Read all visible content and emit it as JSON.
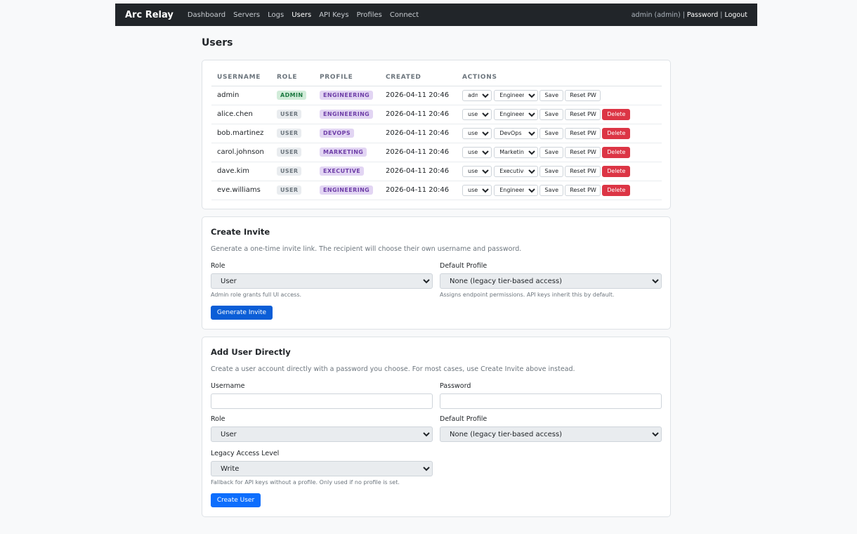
{
  "nav": {
    "brand": "Arc Relay",
    "links": [
      "Dashboard",
      "Servers",
      "Logs",
      "Users",
      "API Keys",
      "Profiles",
      "Connect"
    ],
    "active": "Users",
    "user_label": "admin (admin)",
    "password_link": "Password",
    "logout_link": "Logout",
    "separator": "|"
  },
  "page": {
    "title": "Users"
  },
  "users_table": {
    "headers": [
      "USERNAME",
      "ROLE",
      "PROFILE",
      "CREATED",
      "ACTIONS"
    ],
    "rows": [
      {
        "username": "admin",
        "role_badge": "ADMIN",
        "profile_badge": "ENGINEERING",
        "created": "2026-04-11 20:46",
        "role_select": "admin",
        "profile_select": "Engineering",
        "deletable": false
      },
      {
        "username": "alice.chen",
        "role_badge": "USER",
        "profile_badge": "ENGINEERING",
        "created": "2026-04-11 20:46",
        "role_select": "user",
        "profile_select": "Engineering",
        "deletable": true
      },
      {
        "username": "bob.martinez",
        "role_badge": "USER",
        "profile_badge": "DEVOPS",
        "created": "2026-04-11 20:46",
        "role_select": "user",
        "profile_select": "DevOps",
        "deletable": true
      },
      {
        "username": "carol.johnson",
        "role_badge": "USER",
        "profile_badge": "MARKETING",
        "created": "2026-04-11 20:46",
        "role_select": "user",
        "profile_select": "Marketing",
        "deletable": true
      },
      {
        "username": "dave.kim",
        "role_badge": "USER",
        "profile_badge": "EXECUTIVE",
        "created": "2026-04-11 20:46",
        "role_select": "user",
        "profile_select": "Executive",
        "deletable": true
      },
      {
        "username": "eve.williams",
        "role_badge": "USER",
        "profile_badge": "ENGINEERING",
        "created": "2026-04-11 20:46",
        "role_select": "user",
        "profile_select": "Engineering",
        "deletable": true
      }
    ],
    "save_label": "Save",
    "reset_label": "Reset PW",
    "delete_label": "Delete"
  },
  "invite": {
    "title": "Create Invite",
    "description": "Generate a one-time invite link. The recipient will choose their own username and password.",
    "role_label": "Role",
    "role_value": "User",
    "role_help": "Admin role grants full UI access.",
    "profile_label": "Default Profile",
    "profile_value": "None (legacy tier-based access)",
    "profile_help": "Assigns endpoint permissions. API keys inherit this by default.",
    "button": "Generate Invite"
  },
  "add_user": {
    "title": "Add User Directly",
    "description": "Create a user account directly with a password you choose. For most cases, use Create Invite above instead.",
    "username_label": "Username",
    "username_value": "",
    "password_label": "Password",
    "password_value": "",
    "role_label": "Role",
    "role_value": "User",
    "profile_label": "Default Profile",
    "profile_value": "None (legacy tier-based access)",
    "legacy_label": "Legacy Access Level",
    "legacy_value": "Write",
    "legacy_help": "Fallback for API keys without a profile. Only used if no profile is set.",
    "button": "Create User"
  },
  "colors": {
    "navbar": "#212529",
    "primary": "#0d6efd",
    "danger": "#dc3545",
    "admin_badge": "#d1ecd9",
    "profile_badge": "#e2d5f3"
  }
}
